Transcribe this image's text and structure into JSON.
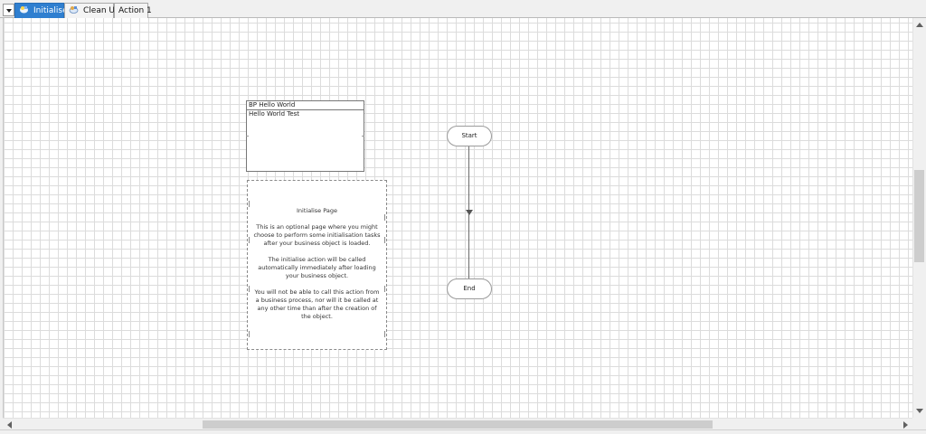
{
  "tabs": [
    {
      "label": "Initialise",
      "active": true,
      "icon": "object-initialise-icon"
    },
    {
      "label": "Clean Up",
      "active": false,
      "icon": "object-cleanup-icon"
    },
    {
      "label": "Action 1",
      "active": false
    }
  ],
  "info_box": {
    "title": "BP Hello World",
    "subtitle": "Hello World Test"
  },
  "note": {
    "title": "Initialise Page",
    "paragraphs": [
      "This is an optional page where you might choose to perform some initialisation tasks after your business object is loaded.",
      "The initialise action will be called automatically immediately after loading your business object.",
      "You will not be able to call this action from a business process, nor will it be called at any other time than after the creation of the object."
    ]
  },
  "flow": {
    "start_label": "Start",
    "end_label": "End"
  },
  "colors": {
    "active_tab": "#2f7fd0",
    "grid_line": "#dcdcdc",
    "canvas": "#ffffff"
  }
}
